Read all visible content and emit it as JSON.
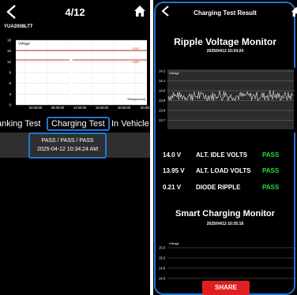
{
  "left": {
    "counter": "4/12",
    "vehicle_id": "YUA2008LTT",
    "chart": {
      "legend": "Voltage",
      "y_ticks": [
        "18",
        "15",
        "12",
        "9",
        "6",
        "3",
        "0"
      ],
      "x_ticks": [
        "04:00:00",
        "08:00:00",
        "12:00:00",
        "16:00:00",
        "20:00:00",
        "00:00:0"
      ],
      "xlabel": "Time(second)",
      "ovp_label": "OVP",
      "uvp_label": "UVP"
    },
    "tabs": [
      "anking Test",
      "Charging Test",
      "In Vehicle T"
    ],
    "active_tab": 1,
    "result_line1": "PASS / PASS / PASS",
    "result_line2": "2025-04-12 10:34:24 AM"
  },
  "right": {
    "title": "Charging Test Result",
    "ripple_title": "Ripple Voltage Monitor",
    "ripple_date": "2025/04/12 10:34:24",
    "ripple_chart": {
      "legend": "Voltage",
      "y_ticks": [
        "14.2",
        "14.1",
        "14.0",
        "13.9",
        "13.8",
        "13.7"
      ]
    },
    "results": [
      {
        "value": "14.0 V",
        "label": "ALT. IDLE VOLTS",
        "status": "PASS"
      },
      {
        "value": "13.95 V",
        "label": "ALT. LOAD VOLTS",
        "status": "PASS"
      },
      {
        "value": "0.21 V",
        "label": "DIODE RIPPLE",
        "status": "PASS"
      }
    ],
    "smart_title": "Smart Charging Monitor",
    "smart_date": "2025/04/12 10:35:18",
    "smart_chart": {
      "legend": "Voltage",
      "y_ticks": [
        "15.5",
        "15.0",
        "14.5",
        "14.0"
      ]
    },
    "share_label": "SHARE"
  },
  "colors": {
    "accent_blue": "#1e78d6",
    "pass_green": "#2ddc3a",
    "share_red": "#e02020",
    "limit_red": "#c0392b"
  },
  "icons": [
    "chevron-left-icon",
    "home-icon"
  ]
}
